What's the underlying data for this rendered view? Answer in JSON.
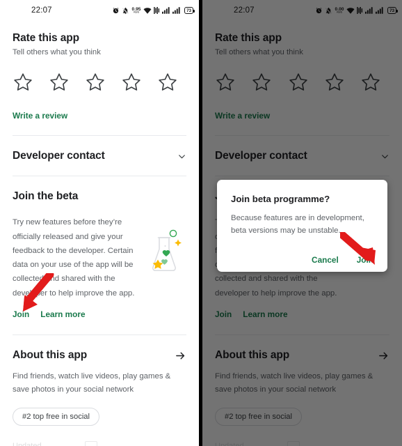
{
  "statusbar": {
    "time": "22:07",
    "net_speed_left": "0.95",
    "net_speed_right": "0.00",
    "net_unit": "KB/S",
    "battery_level": "73",
    "icons": [
      "alarm-icon",
      "bell-muted-icon",
      "network-speed-icon",
      "wifi-icon",
      "vpn-icon",
      "signal-sim1-icon",
      "signal-sim2-icon",
      "battery-icon"
    ]
  },
  "rate": {
    "title": "Rate this app",
    "subtitle": "Tell others what you think",
    "star_count": 5,
    "stars_filled": 0,
    "write_review_label": "Write a review"
  },
  "developer_contact": {
    "label": "Developer contact",
    "expander_icon": "chevron-down-icon"
  },
  "beta": {
    "title": "Join the beta",
    "description": "Try new features before they’re officially released and give your feedback to the developer. Certain data on your use of the app will be collected and shared with the developer to help improve the app.",
    "join_label": "Join",
    "learn_more_label": "Learn more",
    "illustration": "beaker-flask-icon"
  },
  "about": {
    "title": "About this app",
    "arrow_icon": "arrow-right-icon",
    "description": "Find friends, watch live videos, play games & save photos in your social network",
    "chip_label": "#2 top free in social"
  },
  "dialog": {
    "title": "Join beta programme?",
    "message": "Because features are in development, beta versions may be unstable.",
    "cancel_label": "Cancel",
    "join_label": "Join"
  },
  "annotations": {
    "arrow_color": "#e21b1b",
    "left_arrow_target": "Join",
    "right_arrow_target": "Join"
  },
  "colors": {
    "accent_green": "#1a7a4c",
    "text_primary": "#202124",
    "text_secondary": "#5f6368",
    "scrim": "rgba(0,0,0,0.55)",
    "divider": "#e8eaed"
  }
}
